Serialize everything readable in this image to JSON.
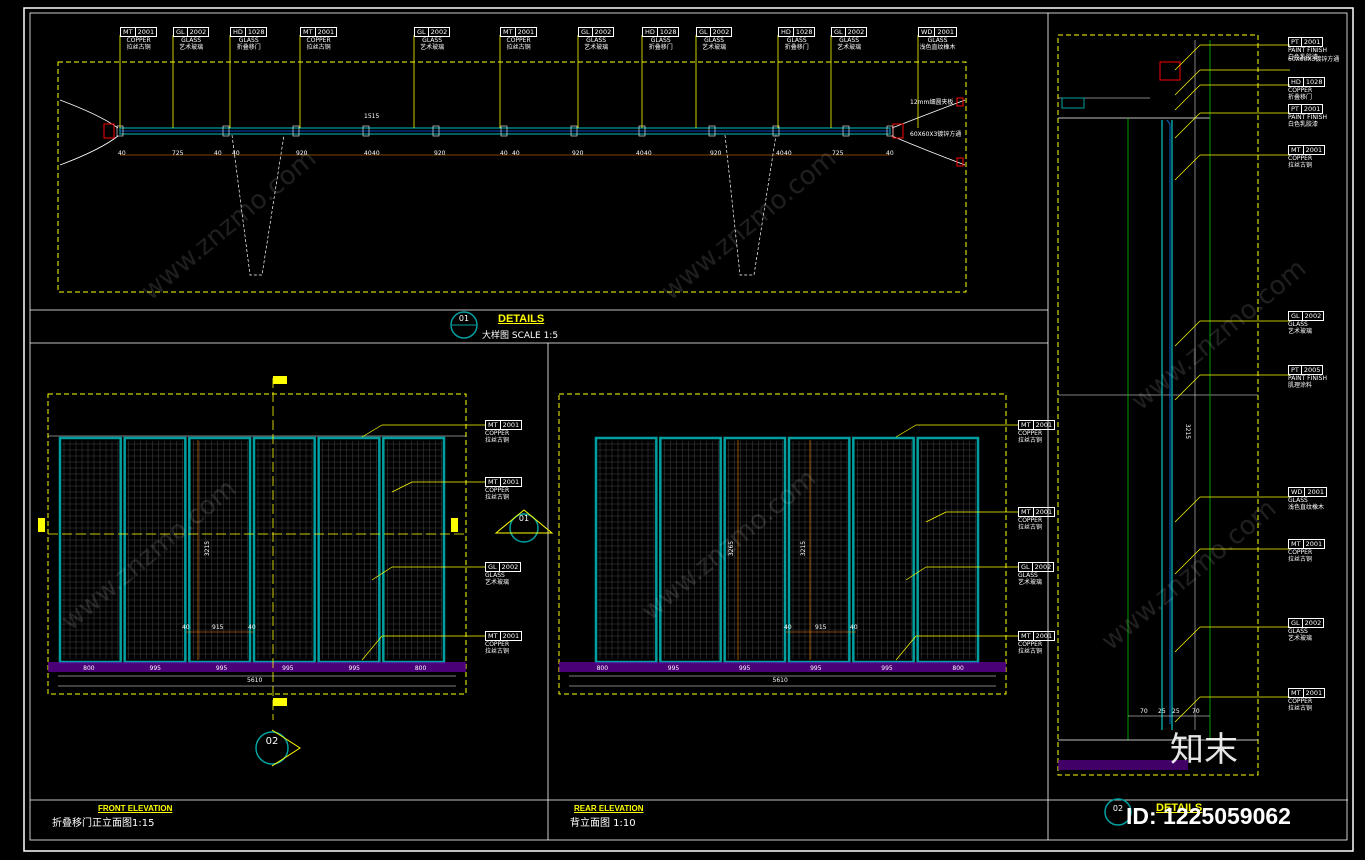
{
  "panels": {
    "plan": {
      "callout": "01",
      "title_en": "DETAILS",
      "title_cn": "大样图 SCALE 1:5",
      "top_tags": [
        {
          "code": "MT",
          "num": "2001",
          "l1": "COPPER",
          "l2": "拉丝古铜"
        },
        {
          "code": "GL",
          "num": "2002",
          "l1": "GLASS",
          "l2": "艺术玻璃"
        },
        {
          "code": "HD",
          "num": "1028",
          "l1": "GLASS",
          "l2": "折叠移门"
        },
        {
          "code": "MT",
          "num": "2001",
          "l1": "COPPER",
          "l2": "拉丝古铜"
        },
        {
          "code": "GL",
          "num": "2002",
          "l1": "GLASS",
          "l2": "艺术玻璃"
        },
        {
          "code": "MT",
          "num": "2001",
          "l1": "COPPER",
          "l2": "拉丝古铜"
        },
        {
          "code": "GL",
          "num": "2002",
          "l1": "GLASS",
          "l2": "艺术玻璃"
        },
        {
          "code": "HD",
          "num": "1028",
          "l1": "GLASS",
          "l2": "折叠移门"
        },
        {
          "code": "GL",
          "num": "2002",
          "l1": "GLASS",
          "l2": "艺术玻璃"
        },
        {
          "code": "HD",
          "num": "1028",
          "l1": "GLASS",
          "l2": "折叠移门"
        },
        {
          "code": "GL",
          "num": "2002",
          "l1": "GLASS",
          "l2": "艺术玻璃"
        },
        {
          "code": "WD",
          "num": "2001",
          "l1": "GLASS",
          "l2": "浅色直纹橡木"
        }
      ],
      "dims": [
        "40",
        "725",
        "40",
        "40",
        "920",
        "40",
        "40",
        "920",
        "40",
        "40",
        "920",
        "40",
        "40",
        "920",
        "40",
        "40",
        "725",
        "40"
      ],
      "small_dim": "1515",
      "right_notes": [
        "12mm细圆夹板",
        "60X60X3镀锌方通"
      ]
    },
    "front": {
      "callout": "02",
      "title_en": "FRONT ELEVATION",
      "title_cn": "折叠移门正立面图1:15",
      "section_callout": "01",
      "tags": [
        {
          "code": "MT",
          "num": "2001",
          "l1": "COPPER",
          "l2": "拉丝古铜"
        },
        {
          "code": "MT",
          "num": "2001",
          "l1": "COPPER",
          "l2": "拉丝古铜"
        },
        {
          "code": "GL",
          "num": "2002",
          "l1": "GLASS",
          "l2": "艺术玻璃"
        },
        {
          "code": "MT",
          "num": "2001",
          "l1": "COPPER",
          "l2": "拉丝古铜"
        }
      ],
      "height": "3215",
      "inner_dims": [
        "40",
        "915",
        "40"
      ],
      "bottom_dims": [
        "800",
        "995",
        "995",
        "995",
        "995",
        "800"
      ],
      "total": "5610"
    },
    "rear": {
      "title_en": "REAR ELEVATION",
      "title_cn": "背立面图 1:10",
      "tags": [
        {
          "code": "MT",
          "num": "2001",
          "l1": "COPPER",
          "l2": "拉丝古铜"
        },
        {
          "code": "MT",
          "num": "2001",
          "l1": "COPPER",
          "l2": "拉丝古铜"
        },
        {
          "code": "GL",
          "num": "2002",
          "l1": "GLASS",
          "l2": "艺术玻璃"
        },
        {
          "code": "MT",
          "num": "2001",
          "l1": "COPPER",
          "l2": "拉丝古铜"
        }
      ],
      "heights": [
        "3265",
        "3215"
      ],
      "inner_dims": [
        "40",
        "915",
        "40"
      ],
      "bottom_dims": [
        "800",
        "995",
        "995",
        "995",
        "995",
        "800"
      ],
      "total": "5610"
    },
    "section": {
      "callout": "02",
      "title_en": "DETAILS",
      "tags": [
        {
          "code": "PT",
          "num": "2001",
          "l1": "PAINT FINISH",
          "l2": "白色乳胶漆"
        },
        {
          "code": "",
          "num": "",
          "l1": "60X60X3镀锌方通",
          "l2": ""
        },
        {
          "code": "HD",
          "num": "1028",
          "l1": "COPPER",
          "l2": "折叠移门"
        },
        {
          "code": "PT",
          "num": "2001",
          "l1": "PAINT FINISH",
          "l2": "白色乳胶漆"
        },
        {
          "code": "MT",
          "num": "2001",
          "l1": "COPPER",
          "l2": "拉丝古铜"
        },
        {
          "code": "GL",
          "num": "2002",
          "l1": "GLASS",
          "l2": "艺术玻璃"
        },
        {
          "code": "PT",
          "num": "2005",
          "l1": "PAINT FINISH",
          "l2": "肌理涂料"
        },
        {
          "code": "WD",
          "num": "2001",
          "l1": "GLASS",
          "l2": "浅色直纹橡木"
        },
        {
          "code": "MT",
          "num": "2001",
          "l1": "COPPER",
          "l2": "拉丝古铜"
        },
        {
          "code": "GL",
          "num": "2002",
          "l1": "GLASS",
          "l2": "艺术玻璃"
        },
        {
          "code": "MT",
          "num": "2001",
          "l1": "COPPER",
          "l2": "拉丝古铜"
        }
      ],
      "height": "3215",
      "bottom_dims": [
        "70",
        "25",
        "25",
        "70"
      ]
    }
  },
  "brand_mark": "知末",
  "id_text": "ID: 1225059062",
  "watermark": "www.znzmo.com",
  "colors": {
    "frame": "#ffffff",
    "dashed": "#ffff00",
    "glass": "#00a0a0",
    "accent": "#ff0000",
    "purple": "#8000c0",
    "green": "#00c000"
  }
}
